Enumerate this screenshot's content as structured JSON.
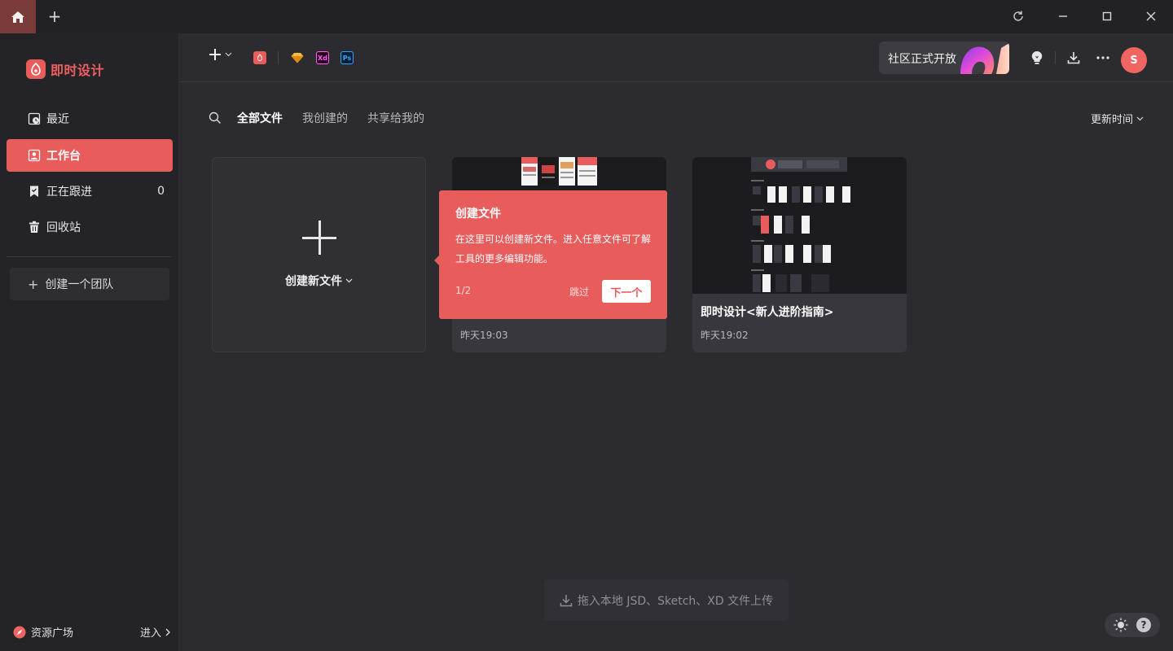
{
  "app": {
    "name": "即时设计",
    "brand_color": "#e95c5c"
  },
  "titlebar": {
    "home_icon": "home-icon",
    "new_tab_icon": "plus-icon",
    "controls": [
      "refresh-icon",
      "minimize-icon",
      "maximize-icon",
      "close-icon"
    ]
  },
  "sidebar": {
    "items": [
      {
        "label": "最近",
        "icon": "clock-icon"
      },
      {
        "label": "工作台",
        "icon": "user-card-icon",
        "active": true
      },
      {
        "label": "正在跟进",
        "icon": "bookmark-icon",
        "count": "0"
      },
      {
        "label": "回收站",
        "icon": "trash-icon"
      }
    ],
    "team_button": "创建一个团队",
    "resource_label": "资源广场",
    "enter_label": "进入"
  },
  "toolbar": {
    "community_label": "社区正式开放",
    "apps": [
      "jsd-icon",
      "sketch-icon",
      "xd-icon",
      "ps-icon"
    ],
    "xd_text": "Xd",
    "ps_text": "Ps",
    "avatar_initial": "S"
  },
  "filters": {
    "tabs": [
      "全部文件",
      "我创建的",
      "共享给我的"
    ],
    "sort_label": "更新时间"
  },
  "cards": {
    "new_label": "创建新文件",
    "files": [
      {
        "title": "",
        "time": "昨天19:03"
      },
      {
        "title": "即时设计<新人进阶指南>",
        "time": "昨天19:02"
      }
    ]
  },
  "tooltip": {
    "title": "创建文件",
    "body": "在这里可以创建新文件。进入任意文件可了解工具的更多编辑功能。",
    "step": "1/2",
    "skip": "跳过",
    "next": "下一个"
  },
  "dropzone": {
    "label": "拖入本地 JSD、Sketch、XD 文件上传"
  },
  "corner": {
    "theme_icon": "sun-icon",
    "help_icon": "help-icon",
    "help_text": "?"
  }
}
